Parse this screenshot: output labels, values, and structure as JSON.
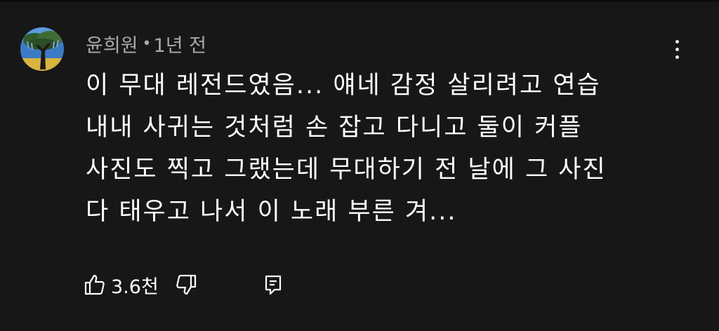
{
  "comment": {
    "author": "윤희원",
    "separator": "•",
    "time": "1년 전",
    "lines": [
      "이 무대 레전드였음... 얘네 감정 살리려고 연습",
      "내내 사귀는 것처럼 손 잡고 다니고 둘이 커플",
      "사진도 찍고 그랬는데 무대하기 전 날에 그 사진",
      "다 태우고 나서 이 노래 부른 겨..."
    ],
    "like_count": "3.6천"
  },
  "icons": {
    "avatar": "avatar-tree-image",
    "more": "more-vert-icon",
    "like": "thumb-up-icon",
    "dislike": "thumb-down-icon",
    "reply": "reply-comment-icon"
  },
  "colors": {
    "background": "#171717",
    "meta_text": "#aaaaaa",
    "body_text": "#ffffff"
  }
}
